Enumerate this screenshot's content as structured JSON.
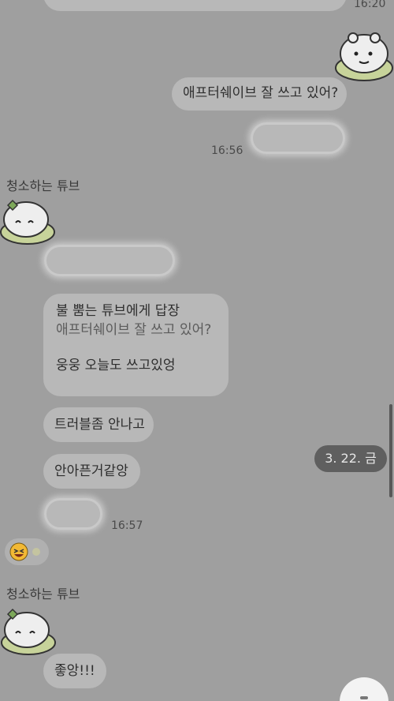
{
  "chat": {
    "times": {
      "t1620": "16:20",
      "t1656": "16:56",
      "t1657": "16:57"
    },
    "sender_name": "청소하는 튜브",
    "messages": {
      "question": "애프터쉐이브 잘 쓰고 있어?",
      "reply_title": "불 뿜는 튜브에게 답장",
      "reply_quote": "애프터쉐이브 잘 쓰고 있어?",
      "reply_answer": "웅웅 오늘도 쓰고있엉",
      "trouble": "트러블좀 안나고",
      "no_pain": "안아픈거같앙",
      "good": "좋앙!!!"
    },
    "date_pill": "3. 22. 금"
  },
  "colors": {
    "background": "#9f9f9f",
    "bubble": "#b8b8b8",
    "date_pill_bg": "#5f5f5f"
  },
  "icons": {
    "avatar": "tube-character-avatar",
    "sticker": "tube-character-sticker",
    "reaction": "laughing-emoji-icon"
  }
}
